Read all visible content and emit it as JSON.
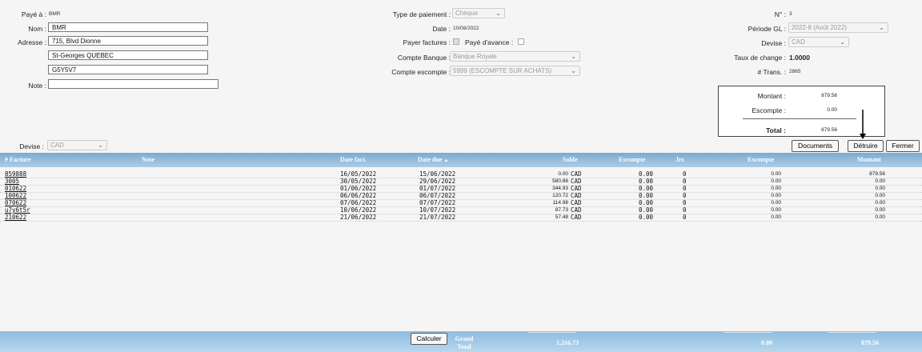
{
  "left": {
    "payee_label": "Payé à :",
    "payee_value": "BMR",
    "name_label": "Nom :",
    "name_value": "BMR",
    "address_label": "Adresse :",
    "address1": "715, Blvd Dionne",
    "address2": "St-Georges QUEBEC",
    "address3": "G5Y5V7",
    "note_label": "Note :",
    "note_value": "",
    "currency_label": "Devise :",
    "currency_value": "CAD"
  },
  "middle": {
    "payment_type_label": "Type de paiement :",
    "payment_type_value": "Chèque",
    "date_label": "Date :",
    "date_value": "10/08/2022",
    "pay_invoices_label": "Payer factures :",
    "paid_advance_label": "Payé d'avance :",
    "bank_account_label": "Compte Banque :",
    "bank_account_value": "Banque Royale",
    "discount_account_label": "Compte escompte :",
    "discount_account_value": "5999 (ESCOMPTE SUR ACHATS)"
  },
  "right": {
    "number_label": "N° :",
    "number_value": "3",
    "period_label": "Période GL :",
    "period_value": "2022-8 (Août 2022)",
    "currency_label": "Devise :",
    "currency_value": "CAD",
    "rate_label": "Taux de change :",
    "rate_value": "1.0000",
    "trans_label": "# Trans. :",
    "trans_value": "2865"
  },
  "totals": {
    "amount_label": "Montant :",
    "amount_value": "879.56",
    "discount_label": "Escompte :",
    "discount_value": "0.00",
    "total_label": "Total :",
    "total_value": "879.56"
  },
  "buttons": {
    "documents": "Documents",
    "delete": "Détruire",
    "close": "Fermer",
    "calculate": "Calculer"
  },
  "table": {
    "headers": [
      "# Facture",
      "Note",
      "Date fact.",
      "Date due",
      "Solde",
      "Escompte",
      "Jrs",
      "Escompte",
      "Montant"
    ],
    "rows": [
      {
        "invoice": "859888",
        "note": "",
        "inv_date": "16/05/2022",
        "due_date": "15/06/2022",
        "balance": "0.00",
        "cur": "CAD",
        "discount": "0.00",
        "days": "0",
        "discount2": "0.00",
        "amount": "879.56"
      },
      {
        "invoice": "3005",
        "note": "",
        "inv_date": "30/05/2022",
        "due_date": "29/06/2022",
        "balance": "580.88",
        "cur": "CAD",
        "discount": "0.00",
        "days": "0",
        "discount2": "0.00",
        "amount": "0.00"
      },
      {
        "invoice": "010622",
        "note": "",
        "inv_date": "01/06/2022",
        "due_date": "01/07/2022",
        "balance": "344.93",
        "cur": "CAD",
        "discount": "0.00",
        "days": "0",
        "discount2": "0.00",
        "amount": "0.00"
      },
      {
        "invoice": "100622",
        "note": "",
        "inv_date": "06/06/2022",
        "due_date": "06/07/2022",
        "balance": "120.72",
        "cur": "CAD",
        "discount": "0.00",
        "days": "0",
        "discount2": "0.00",
        "amount": "0.00"
      },
      {
        "invoice": "070622",
        "note": "",
        "inv_date": "07/06/2022",
        "due_date": "07/07/2022",
        "balance": "114.98",
        "cur": "CAD",
        "discount": "0.00",
        "days": "0",
        "discount2": "0.00",
        "amount": "0.00"
      },
      {
        "invoice": "u7y6t5r",
        "note": "",
        "inv_date": "10/06/2022",
        "due_date": "10/07/2022",
        "balance": "87.73",
        "cur": "CAD",
        "discount": "0.00",
        "days": "0",
        "discount2": "0.00",
        "amount": "0.00"
      },
      {
        "invoice": "210622",
        "note": "",
        "inv_date": "21/06/2022",
        "due_date": "21/07/2022",
        "balance": "57.48",
        "cur": "CAD",
        "discount": "0.00",
        "days": "0",
        "discount2": "0.00",
        "amount": "0.00"
      }
    ]
  },
  "footer": {
    "grand_total_label": "Grand Total",
    "balance_total": "1,316.73",
    "discount_total": "0.00",
    "amount_total": "879.56"
  }
}
